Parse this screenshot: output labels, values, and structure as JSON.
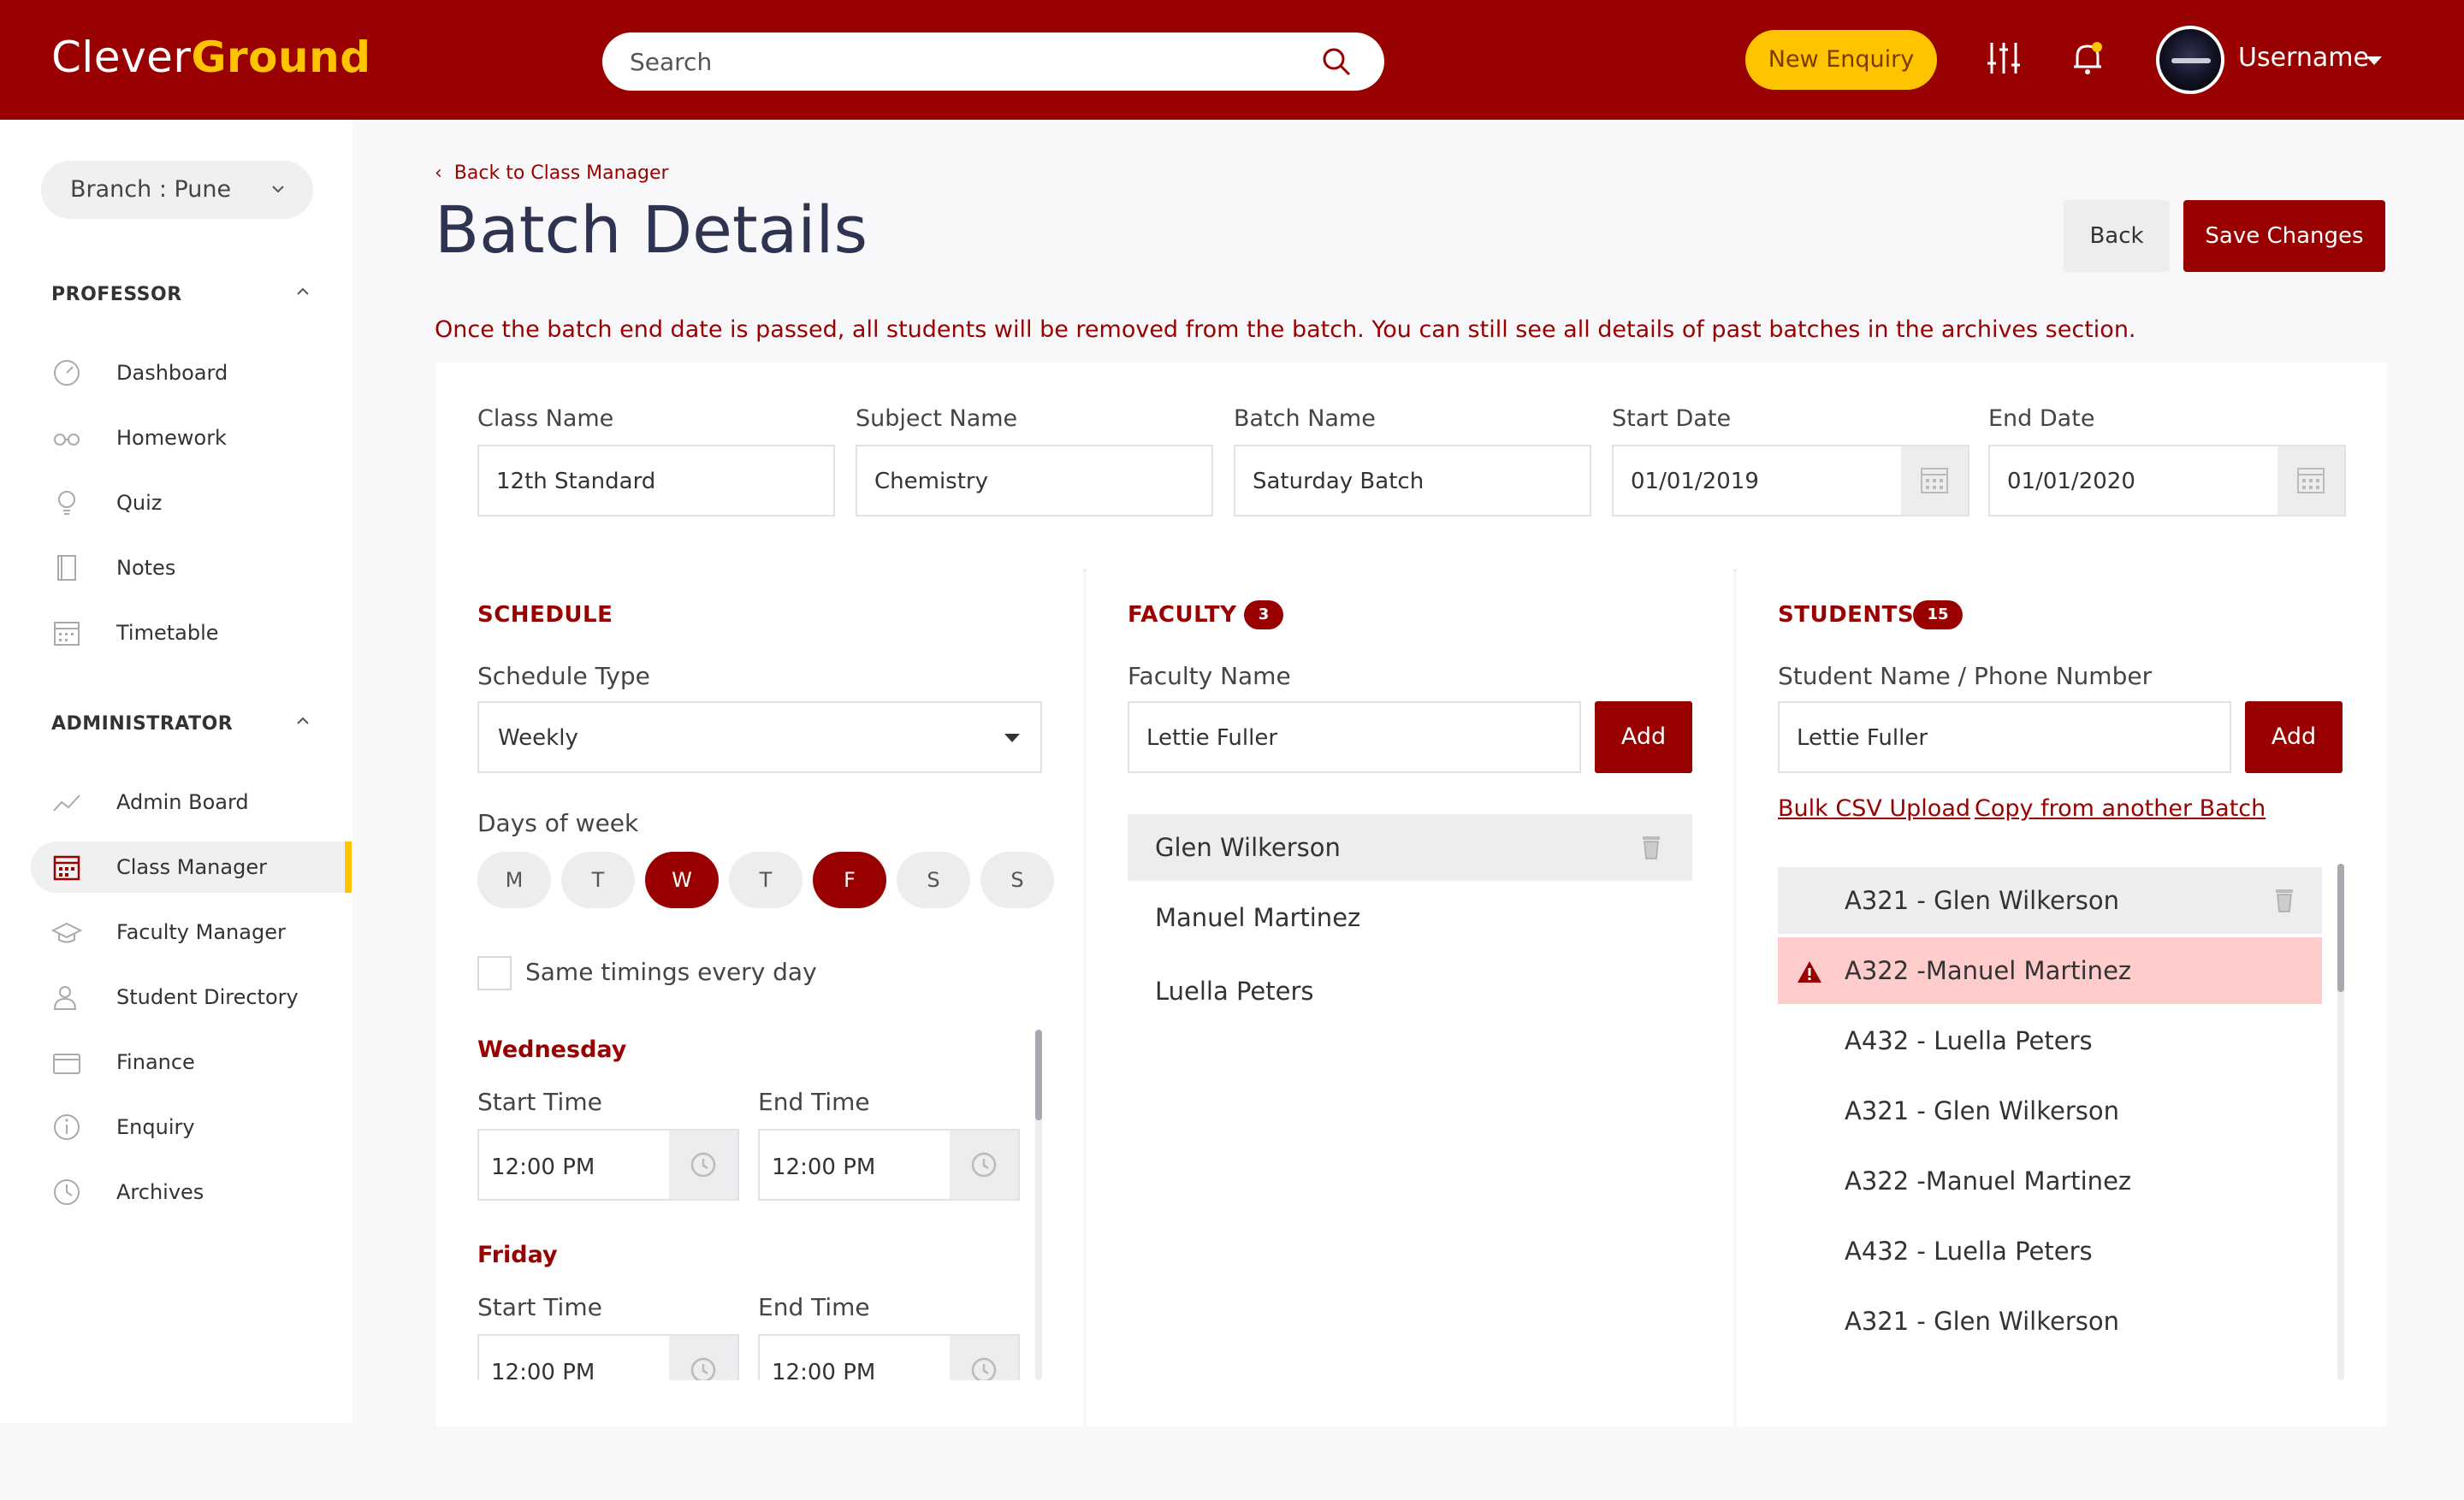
{
  "header": {
    "logo_part1": "Clever",
    "logo_part2": "Ground",
    "search_placeholder": "Search",
    "new_enquiry_label": "New Enquiry",
    "username": "Username"
  },
  "sidebar": {
    "branch_label": "Branch : Pune",
    "professor_section": "PROFESSOR",
    "professor_items": [
      "Dashboard",
      "Homework",
      "Quiz",
      "Notes",
      "Timetable"
    ],
    "administrator_section": "ADMINISTRATOR",
    "admin_items": [
      "Admin Board",
      "Class Manager",
      "Faculty Manager",
      "Student Directory",
      "Finance",
      "Enquiry",
      "Archives"
    ],
    "active_item": "Class Manager"
  },
  "page": {
    "breadcrumb": "Back to Class Manager",
    "title": "Batch Details",
    "back_label": "Back",
    "save_label": "Save Changes",
    "warning": "Once the batch end date is passed, all students will be removed from the batch. You can still see all details of past batches in the archives section."
  },
  "details": {
    "class_name_label": "Class Name",
    "class_name_value": "12th Standard",
    "subject_name_label": "Subject Name",
    "subject_name_value": "Chemistry",
    "batch_name_label": "Batch Name",
    "batch_name_value": "Saturday Batch",
    "start_date_label": "Start Date",
    "start_date_value": "01/01/2019",
    "end_date_label": "End Date",
    "end_date_value": "01/01/2020"
  },
  "schedule": {
    "heading": "SCHEDULE",
    "type_label": "Schedule Type",
    "type_value": "Weekly",
    "days_label": "Days of week",
    "days": [
      "M",
      "T",
      "W",
      "T",
      "F",
      "S",
      "S"
    ],
    "selected_days": [
      2,
      4
    ],
    "same_timings_label": "Same timings every day",
    "entries": [
      {
        "day": "Wednesday",
        "start_label": "Start Time",
        "start_value": "12:00 PM",
        "end_label": "End Time",
        "end_value": "12:00 PM"
      },
      {
        "day": "Friday",
        "start_label": "Start Time",
        "start_value": "12:00 PM",
        "end_label": "End Time",
        "end_value": "12:00 PM"
      }
    ]
  },
  "faculty": {
    "heading": "FACULTY",
    "count": "3",
    "input_label": "Faculty Name",
    "input_value": "Lettie Fuller",
    "add_label": "Add",
    "items": [
      "Glen Wilkerson",
      "Manuel Martinez",
      "Luella Peters"
    ]
  },
  "students": {
    "heading": "STUDENTS",
    "count": "15",
    "input_label": "Student Name / Phone Number",
    "input_value": "Lettie Fuller",
    "add_label": "Add",
    "bulk_upload": "Bulk CSV Upload",
    "copy_batch": "Copy from another Batch",
    "items": [
      "A321 - Glen Wilkerson",
      "A322 -Manuel Martinez",
      "A432 - Luella Peters",
      "A321 - Glen Wilkerson",
      "A322 -Manuel Martinez",
      "A432 - Luella Peters",
      "A321 - Glen Wilkerson"
    ]
  },
  "colors": {
    "brand": "#990000",
    "accent": "#ffc400",
    "error_row": "#ffcccc"
  }
}
